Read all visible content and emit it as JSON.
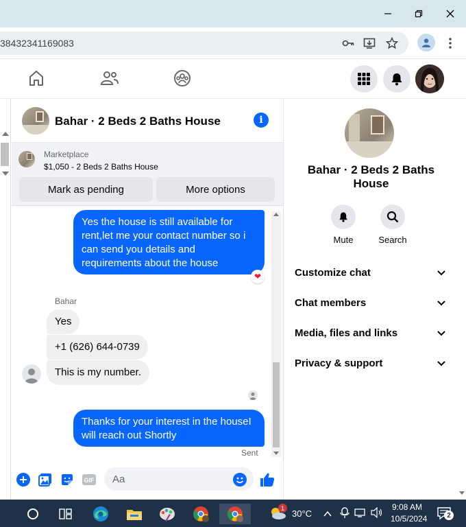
{
  "browser": {
    "url": "38432341169083"
  },
  "chat": {
    "title": "Bahar · 2 Beds 2 Baths House"
  },
  "marketplace": {
    "label": "Marketplace",
    "description": "$1,050 - 2 Beds 2 Baths House",
    "mark_pending": "Mark as pending",
    "more_options": "More options"
  },
  "messages": {
    "out1": "Yes the house is still available for rent,let me your contact number so i can send you details and requirements about the house",
    "sender": "Bahar",
    "in1": "Yes",
    "in2": "+1 (626) 644-0739",
    "in3": "This is my number.",
    "out2": "Thanks for your interest in the houseI will reach out Shortly",
    "status": "Sent"
  },
  "composer": {
    "placeholder": "Aa"
  },
  "right_panel": {
    "name": "Bahar · 2 Beds 2 Baths House",
    "mute": "Mute",
    "search": "Search",
    "sections": [
      "Customize chat",
      "Chat members",
      "Media, files and links",
      "Privacy & support"
    ]
  },
  "taskbar": {
    "temp": "30°C",
    "time": "9:08 AM",
    "date": "10/5/2024",
    "weather_badge": "1",
    "notif_count": "2"
  },
  "colors": {
    "messenger_blue": "#0866ff",
    "bubble_gray": "#f0f0f0",
    "taskbar": "#1f3146"
  }
}
